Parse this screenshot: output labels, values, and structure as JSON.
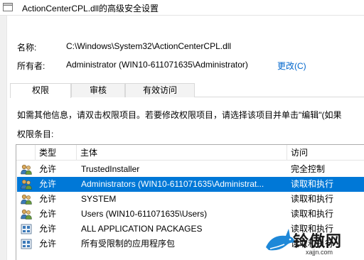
{
  "window": {
    "title": "ActionCenterCPL.dll的高级安全设置"
  },
  "name_row": {
    "label": "名称:",
    "value": "C:\\Windows\\System32\\ActionCenterCPL.dll"
  },
  "owner_row": {
    "label": "所有者:",
    "value": "Administrator (WIN10-611071635\\Administrator)",
    "change_link": "更改(C)"
  },
  "tabs": [
    {
      "label": "权限",
      "active": true
    },
    {
      "label": "审核",
      "active": false
    },
    {
      "label": "有效访问",
      "active": false
    }
  ],
  "info_text": "如需其他信息，请双击权限项目。若要修改权限项目，请选择该项目并单击\"编辑\"(如果",
  "entries_label": "权限条目:",
  "table": {
    "columns": [
      "类型",
      "主体",
      "访问"
    ],
    "rows": [
      {
        "icon": "users-icon",
        "type": "允许",
        "principal": "TrustedInstaller",
        "access": "完全控制",
        "selected": false
      },
      {
        "icon": "users-icon",
        "type": "允许",
        "principal": "Administrators (WIN10-611071635\\Administrat...",
        "access": "读取和执行",
        "selected": true
      },
      {
        "icon": "users-icon",
        "type": "允许",
        "principal": "SYSTEM",
        "access": "读取和执行",
        "selected": false
      },
      {
        "icon": "users-icon",
        "type": "允许",
        "principal": "Users (WIN10-611071635\\Users)",
        "access": "读取和执行",
        "selected": false
      },
      {
        "icon": "package-icon",
        "type": "允许",
        "principal": "ALL APPLICATION PACKAGES",
        "access": "读取和执行",
        "selected": false
      },
      {
        "icon": "package-icon",
        "type": "允许",
        "principal": "所有受限制的应用程序包",
        "access": "读取和执行",
        "selected": false
      }
    ]
  },
  "watermark": {
    "text": "铃傲网",
    "url": "xajjn.com"
  },
  "colors": {
    "selection": "#0078d7",
    "link": "#0066cc",
    "watermark_shark": "#1e88d8"
  }
}
